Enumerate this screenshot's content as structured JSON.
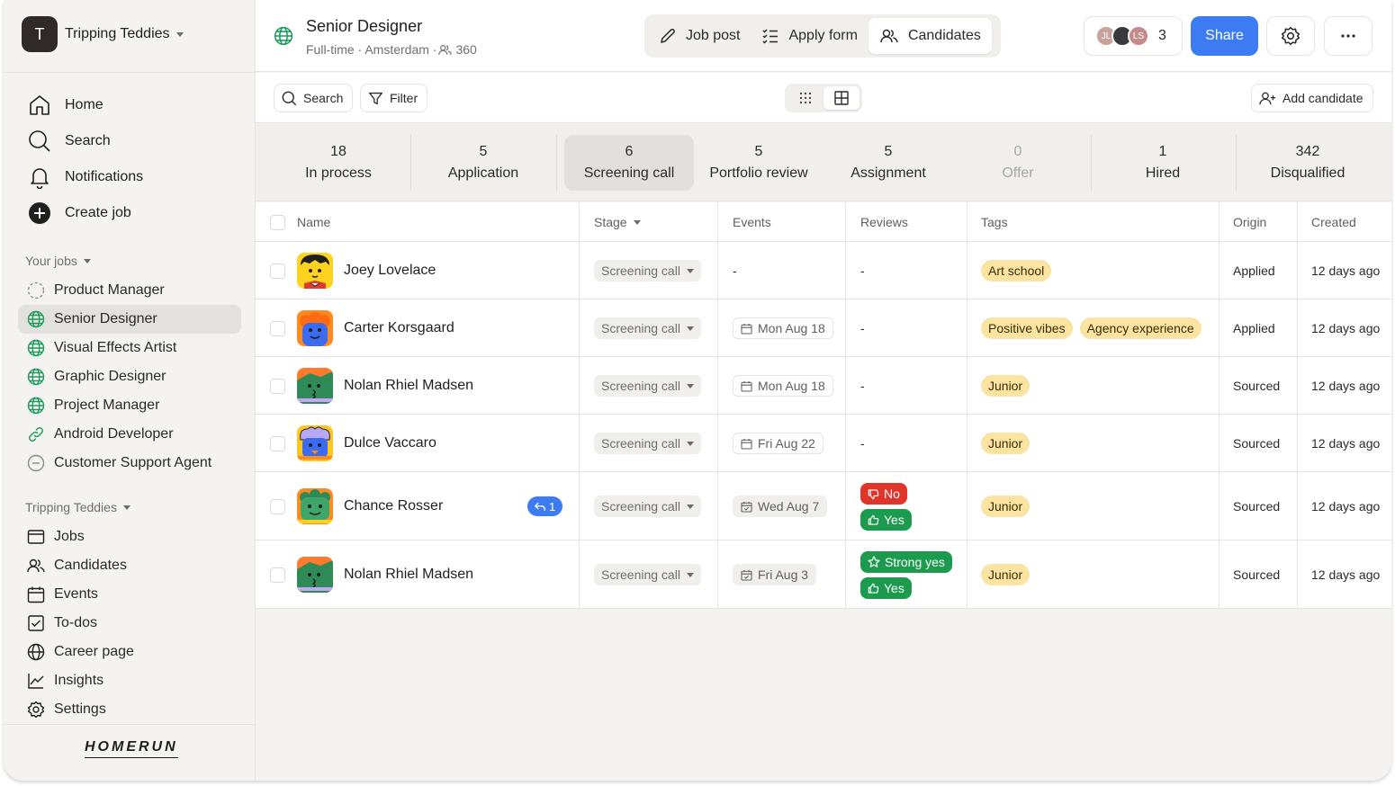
{
  "workspace": {
    "initial": "T",
    "name": "Tripping Teddies"
  },
  "nav": [
    {
      "label": "Home",
      "icon": "home-icon"
    },
    {
      "label": "Search",
      "icon": "search-icon"
    },
    {
      "label": "Notifications",
      "icon": "bell-icon"
    },
    {
      "label": "Create job",
      "icon": "plus-circle-icon"
    }
  ],
  "your_jobs": {
    "title": "Your jobs",
    "items": [
      {
        "label": "Product Manager",
        "icon": "draft-circle-icon"
      },
      {
        "label": "Senior Designer",
        "icon": "globe-icon",
        "active": true
      },
      {
        "label": "Visual Effects Artist",
        "icon": "globe-icon"
      },
      {
        "label": "Graphic Designer",
        "icon": "globe-icon"
      },
      {
        "label": "Project Manager",
        "icon": "globe-icon"
      },
      {
        "label": "Android Developer",
        "icon": "link-icon"
      },
      {
        "label": "Customer Support Agent",
        "icon": "minus-circle-icon"
      }
    ]
  },
  "company": {
    "title": "Tripping Teddies",
    "items": [
      {
        "label": "Jobs",
        "icon": "jobs-icon"
      },
      {
        "label": "Candidates",
        "icon": "people-icon"
      },
      {
        "label": "Events",
        "icon": "calendar-icon"
      },
      {
        "label": "To-dos",
        "icon": "checkbox-icon"
      },
      {
        "label": "Career page",
        "icon": "globe-icon"
      },
      {
        "label": "Insights",
        "icon": "chart-icon"
      },
      {
        "label": "Settings",
        "icon": "gear-icon"
      }
    ]
  },
  "logo": "HOMERUN",
  "job": {
    "title": "Senior Designer",
    "subtitle": "Full-time · Amsterdam · ",
    "candidates_count": "360"
  },
  "tabs": [
    {
      "label": "Job post",
      "icon": "pencil-icon"
    },
    {
      "label": "Apply form",
      "icon": "list-check-icon"
    },
    {
      "label": "Candidates",
      "icon": "people-icon",
      "active": true
    }
  ],
  "collaborators": {
    "avatars": [
      {
        "initials": "JL",
        "color": "#c9a39a"
      },
      {
        "initials": "",
        "color": "#3a3a3a"
      },
      {
        "initials": "LS",
        "color": "#c48b8b"
      }
    ],
    "count": "3"
  },
  "share_label": "Share",
  "toolbar": {
    "search": "Search",
    "filter": "Filter",
    "add_candidate": "Add candidate"
  },
  "stages": [
    {
      "count": "18",
      "label": "In process"
    },
    {
      "count": "5",
      "label": "Application"
    },
    {
      "count": "6",
      "label": "Screening call",
      "active": true
    },
    {
      "count": "5",
      "label": "Portfolio review"
    },
    {
      "count": "5",
      "label": "Assignment"
    },
    {
      "count": "0",
      "label": "Offer",
      "dim": true
    },
    {
      "count": "1",
      "label": "Hired"
    },
    {
      "count": "342",
      "label": "Disqualified"
    }
  ],
  "columns": {
    "name": "Name",
    "stage": "Stage",
    "events": "Events",
    "reviews": "Reviews",
    "tags": "Tags",
    "origin": "Origin",
    "created": "Created"
  },
  "candidates": [
    {
      "name": "Joey Lovelace",
      "stage": "Screening call",
      "event": "-",
      "reviews": "-",
      "tags": [
        "Art school"
      ],
      "origin": "Applied",
      "created": "12 days ago"
    },
    {
      "name": "Carter Korsgaard",
      "stage": "Screening call",
      "event": "Mon Aug 18",
      "reviews": "-",
      "tags": [
        "Positive vibes",
        "Agency experience"
      ],
      "origin": "Applied",
      "created": "12 days ago"
    },
    {
      "name": "Nolan Rhiel Madsen",
      "stage": "Screening call",
      "event": "Mon Aug 18",
      "reviews": "-",
      "tags": [
        "Junior"
      ],
      "origin": "Sourced",
      "created": "12 days ago"
    },
    {
      "name": "Dulce Vaccaro",
      "stage": "Screening call",
      "event": "Fri Aug 22",
      "reviews": "-",
      "tags": [
        "Junior"
      ],
      "origin": "Sourced",
      "created": "12 days ago"
    },
    {
      "name": "Chance Rosser",
      "reply_count": "1",
      "stage": "Screening call",
      "event": "Wed Aug 7",
      "review_badges": [
        "No",
        "Yes"
      ],
      "tags": [
        "Junior"
      ],
      "origin": "Sourced",
      "created": "12 days ago"
    },
    {
      "name": "Nolan Rhiel Madsen",
      "stage": "Screening call",
      "event": "Fri Aug 3",
      "review_badges": [
        "Strong yes",
        "Yes"
      ],
      "tags": [
        "Junior"
      ],
      "origin": "Sourced",
      "created": "12 days ago"
    }
  ],
  "colors": {
    "accent": "#3d7bf2",
    "tag": "#fbe3a1",
    "review_no": "#e0352b",
    "review_yes": "#1c9b4f",
    "globe": "#1d9b5c"
  }
}
